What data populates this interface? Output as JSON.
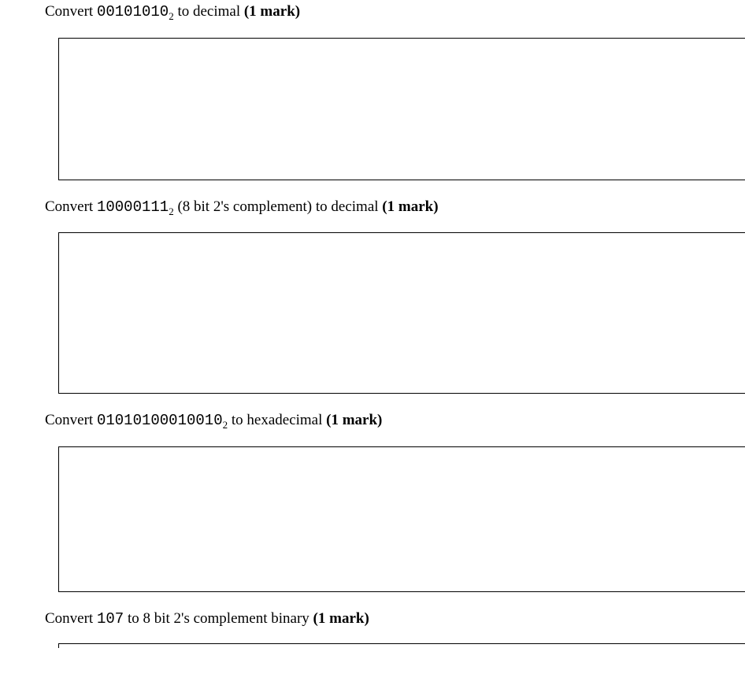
{
  "questions": [
    {
      "prefix": "Convert ",
      "value": "00101010",
      "subscript": "2",
      "middle": " to decimal  ",
      "marks": "(1 mark)"
    },
    {
      "prefix": "Convert ",
      "value": "10000111",
      "subscript": "2",
      "middle": " (8 bit 2's complement) to decimal ",
      "marks": "(1 mark)"
    },
    {
      "prefix": "Convert ",
      "value": "01010100010010",
      "subscript": "2",
      "middle": " to hexadecimal ",
      "marks": "(1 mark)"
    },
    {
      "prefix": "Convert ",
      "value": "107",
      "subscript": "",
      "middle": " to 8 bit 2's complement binary ",
      "marks": "(1 mark)"
    }
  ]
}
